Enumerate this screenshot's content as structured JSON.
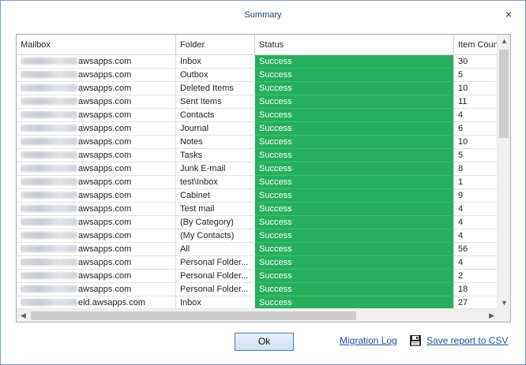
{
  "dialog": {
    "title": "Summary",
    "close_glyph": "×"
  },
  "grid": {
    "columns": [
      "Mailbox",
      "Folder",
      "Status",
      "Item Count"
    ],
    "rows": [
      {
        "mailbox": "awsapps.com",
        "folder": "Inbox",
        "status": "Success",
        "count": "30"
      },
      {
        "mailbox": "awsapps.com",
        "folder": "Outbox",
        "status": "Success",
        "count": "5"
      },
      {
        "mailbox": "awsapps.com",
        "folder": "Deleted Items",
        "status": "Success",
        "count": "10"
      },
      {
        "mailbox": "awsapps.com",
        "folder": "Sent Items",
        "status": "Success",
        "count": "11"
      },
      {
        "mailbox": "awsapps.com",
        "folder": "Contacts",
        "status": "Success",
        "count": "4"
      },
      {
        "mailbox": "awsapps.com",
        "folder": "Journal",
        "status": "Success",
        "count": "6"
      },
      {
        "mailbox": "awsapps.com",
        "folder": "Notes",
        "status": "Success",
        "count": "10"
      },
      {
        "mailbox": "awsapps.com",
        "folder": "Tasks",
        "status": "Success",
        "count": "5"
      },
      {
        "mailbox": "awsapps.com",
        "folder": "Junk E-mail",
        "status": "Success",
        "count": "8"
      },
      {
        "mailbox": "awsapps.com",
        "folder": "test\\Inbox",
        "status": "Success",
        "count": "1"
      },
      {
        "mailbox": "awsapps.com",
        "folder": "Cabinet",
        "status": "Success",
        "count": "9"
      },
      {
        "mailbox": "awsapps.com",
        "folder": "Test mail",
        "status": "Success",
        "count": "4"
      },
      {
        "mailbox": "awsapps.com",
        "folder": "(By Category)",
        "status": "Success",
        "count": "4"
      },
      {
        "mailbox": "awsapps.com",
        "folder": "(My Contacts)",
        "status": "Success",
        "count": "4"
      },
      {
        "mailbox": "awsapps.com",
        "folder": "All",
        "status": "Success",
        "count": "56"
      },
      {
        "mailbox": "awsapps.com",
        "folder": "Personal Folder...",
        "status": "Success",
        "count": "4"
      },
      {
        "mailbox": "awsapps.com",
        "folder": "Personal Folder...",
        "status": "Success",
        "count": "2"
      },
      {
        "mailbox": "awsapps.com",
        "folder": "Personal Folder...",
        "status": "Success",
        "count": "18"
      },
      {
        "mailbox": "eld.awsapps.com",
        "folder": "Inbox",
        "status": "Success",
        "count": "27"
      }
    ]
  },
  "footer": {
    "ok_label": "Ok",
    "migration_log_label": "Migration Log",
    "save_csv_label": "Save report to CSV"
  },
  "colors": {
    "success": "#27ae5f",
    "link": "#1a4fa3"
  }
}
